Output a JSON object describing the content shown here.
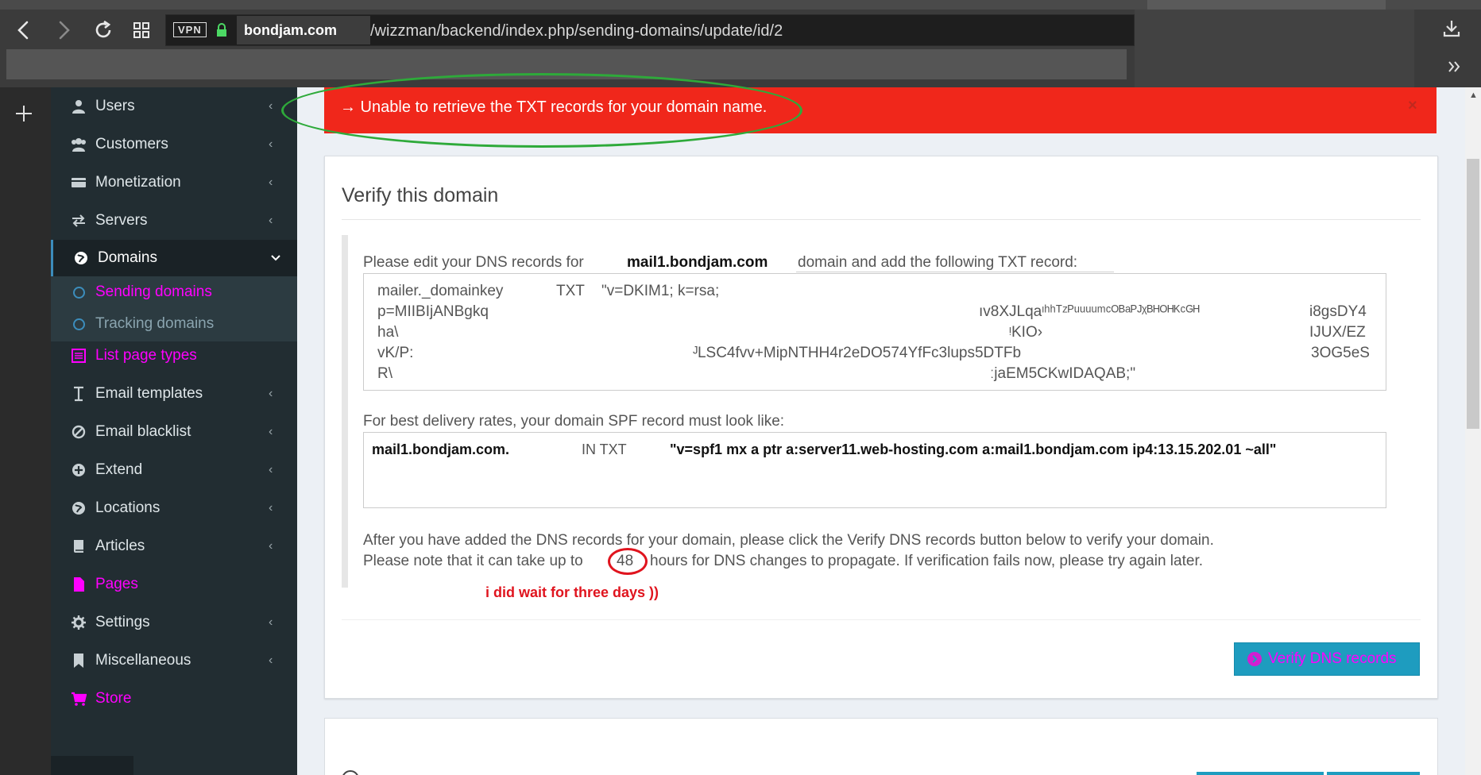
{
  "browser": {
    "vpn_label": "VPN",
    "domain": "bondjam.com",
    "path": "/wizzman/backend/index.php/sending-domains/update/id/2"
  },
  "sidebar": {
    "items": [
      {
        "label": "Users",
        "icon": "user-icon"
      },
      {
        "label": "Customers",
        "icon": "users-icon"
      },
      {
        "label": "Monetization",
        "icon": "credit-card-icon"
      },
      {
        "label": "Servers",
        "icon": "exchange-icon"
      },
      {
        "label": "Domains",
        "icon": "globe-icon"
      },
      {
        "label": "List page types",
        "icon": "list-icon"
      },
      {
        "label": "Email templates",
        "icon": "text-cursor-icon"
      },
      {
        "label": "Email blacklist",
        "icon": "ban-icon"
      },
      {
        "label": "Extend",
        "icon": "plus-circle-icon"
      },
      {
        "label": "Locations",
        "icon": "globe-icon"
      },
      {
        "label": "Articles",
        "icon": "book-icon"
      },
      {
        "label": "Pages",
        "icon": "file-icon"
      },
      {
        "label": "Settings",
        "icon": "gear-icon"
      },
      {
        "label": "Miscellaneous",
        "icon": "bookmark-icon"
      },
      {
        "label": "Store",
        "icon": "cart-icon"
      }
    ],
    "submenu": [
      {
        "label": "Sending domains"
      },
      {
        "label": "Tracking domains"
      }
    ]
  },
  "alert": {
    "message": "→ Unable to retrieve the TXT records for your domain name.",
    "close": "×"
  },
  "box": {
    "title": "Verify this domain",
    "instr_a": "Please edit your DNS records for",
    "instr_domain": "mail1.bondjam.com",
    "instr_b": "domain and add the following TXT record:",
    "dkim": {
      "host": "mailer._domainkey",
      "type": "TXT",
      "value_start": "\"v=DKIM1; k=rsa;",
      "l2a": "p=MIIBIjANBgkq",
      "l2b": "ıv8XJLqaᶦʰʰᵀᶻᴾᵘᵘᵘᵘᵐᶜᴼᴮᵃᴾᴶᵡᴮᴴᴼᴴᴷᶜᴳᴴ",
      "l2c": "i8gsDY4",
      "l3a": "ha\\",
      "l3b": "ᵎKIO›",
      "l3c": "IJUX/EZ",
      "l4a": "vK/P:",
      "l4b": "ᴶLSC4fvv+MipNTHH4r2eDO574YfFc3lups5DTFb",
      "l4c": "3OG5eS",
      "l5a": "R\\",
      "l5b": "ːjaEM5CKwIDAQAB;\""
    },
    "spf_label": "For best delivery rates, your domain SPF record must look like:",
    "spf": {
      "host": "mail1.bondjam.com.",
      "type": "IN TXT",
      "value": "\"v=spf1 mx a ptr a:server11.web-hosting.com a:mail1.bondjam.com ip4:13.15.202.01 ~all\""
    },
    "after_1": "After you have added the DNS records for your domain, please click the Verify DNS records button below to verify your domain.",
    "after_2a": "Please note that it can take up to",
    "after_2_num": "48",
    "after_2b": "hours for DNS changes to propagate. If verification fails now, please try again later.",
    "annotation": "i did wait for three days ))",
    "verify_button": "Verify DNS records"
  }
}
